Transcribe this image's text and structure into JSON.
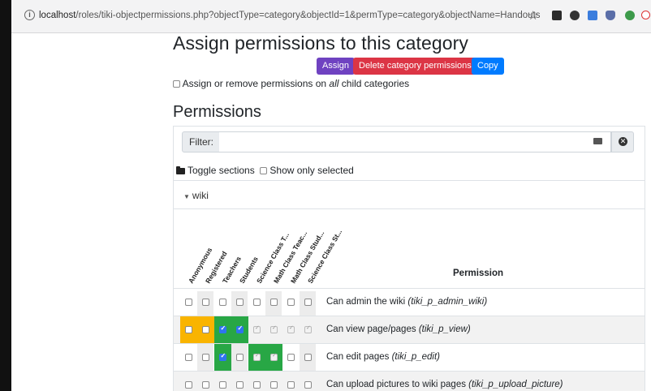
{
  "browser": {
    "url_host": "localhost",
    "url_rest": "/roles/tiki-objectpermissions.php?objectType=category&objectId=1&permType=category&objectName=Handouts"
  },
  "page": {
    "title": "Assign permissions to this category",
    "buttons": {
      "assign": "Assign",
      "delete": "Delete category permissions",
      "copy": "Copy"
    },
    "child_text_a": "Assign or remove permissions on ",
    "child_text_em": "all",
    "child_text_b": " child categories",
    "permissions_heading": "Permissions"
  },
  "filter": {
    "label": "Filter:",
    "value": ""
  },
  "toggles": {
    "toggle_sections": "Toggle sections",
    "show_only_selected": "Show only selected"
  },
  "section": {
    "name": "wiki"
  },
  "groups": [
    "Anonymous",
    "Registered",
    "Teachers",
    "Students",
    "Science Class T...",
    "Math Class Teac...",
    "Math Class Stud...",
    "Science Class St..."
  ],
  "permission_header": "Permission",
  "rows": [
    {
      "label": "Can admin the wiki ",
      "code": "(tiki_p_admin_wiki)",
      "states": [
        "off",
        "off",
        "off",
        "off",
        "off",
        "off",
        "off",
        "off"
      ],
      "bg": [
        "",
        "",
        "",
        "",
        "",
        "",
        "",
        ""
      ]
    },
    {
      "label": "Can view page/pages ",
      "code": "(tiki_p_view)",
      "states": [
        "off",
        "off",
        "on",
        "on",
        "dis",
        "dis",
        "dis",
        "dis"
      ],
      "bg": [
        "#f9b400",
        "#f9b400",
        "#28a745",
        "#28a745",
        "",
        "",
        "",
        ""
      ]
    },
    {
      "label": "Can edit pages ",
      "code": "(tiki_p_edit)",
      "states": [
        "off",
        "off",
        "on",
        "off",
        "dis",
        "dis",
        "off",
        "off"
      ],
      "bg": [
        "",
        "",
        "#28a745",
        "",
        "#28a745",
        "#28a745",
        "",
        ""
      ]
    },
    {
      "label": "Can upload pictures to wiki pages ",
      "code": "(tiki_p_upload_picture)",
      "states": [
        "off",
        "off",
        "off",
        "off",
        "off",
        "off",
        "off",
        "off"
      ],
      "bg": [
        "",
        "",
        "",
        "",
        "",
        "",
        "",
        ""
      ]
    }
  ],
  "colors": {
    "assign": "#6f42c1",
    "delete": "#dc3545",
    "copy": "#007bff",
    "inherited": "#f9b400",
    "granted": "#28a745"
  }
}
